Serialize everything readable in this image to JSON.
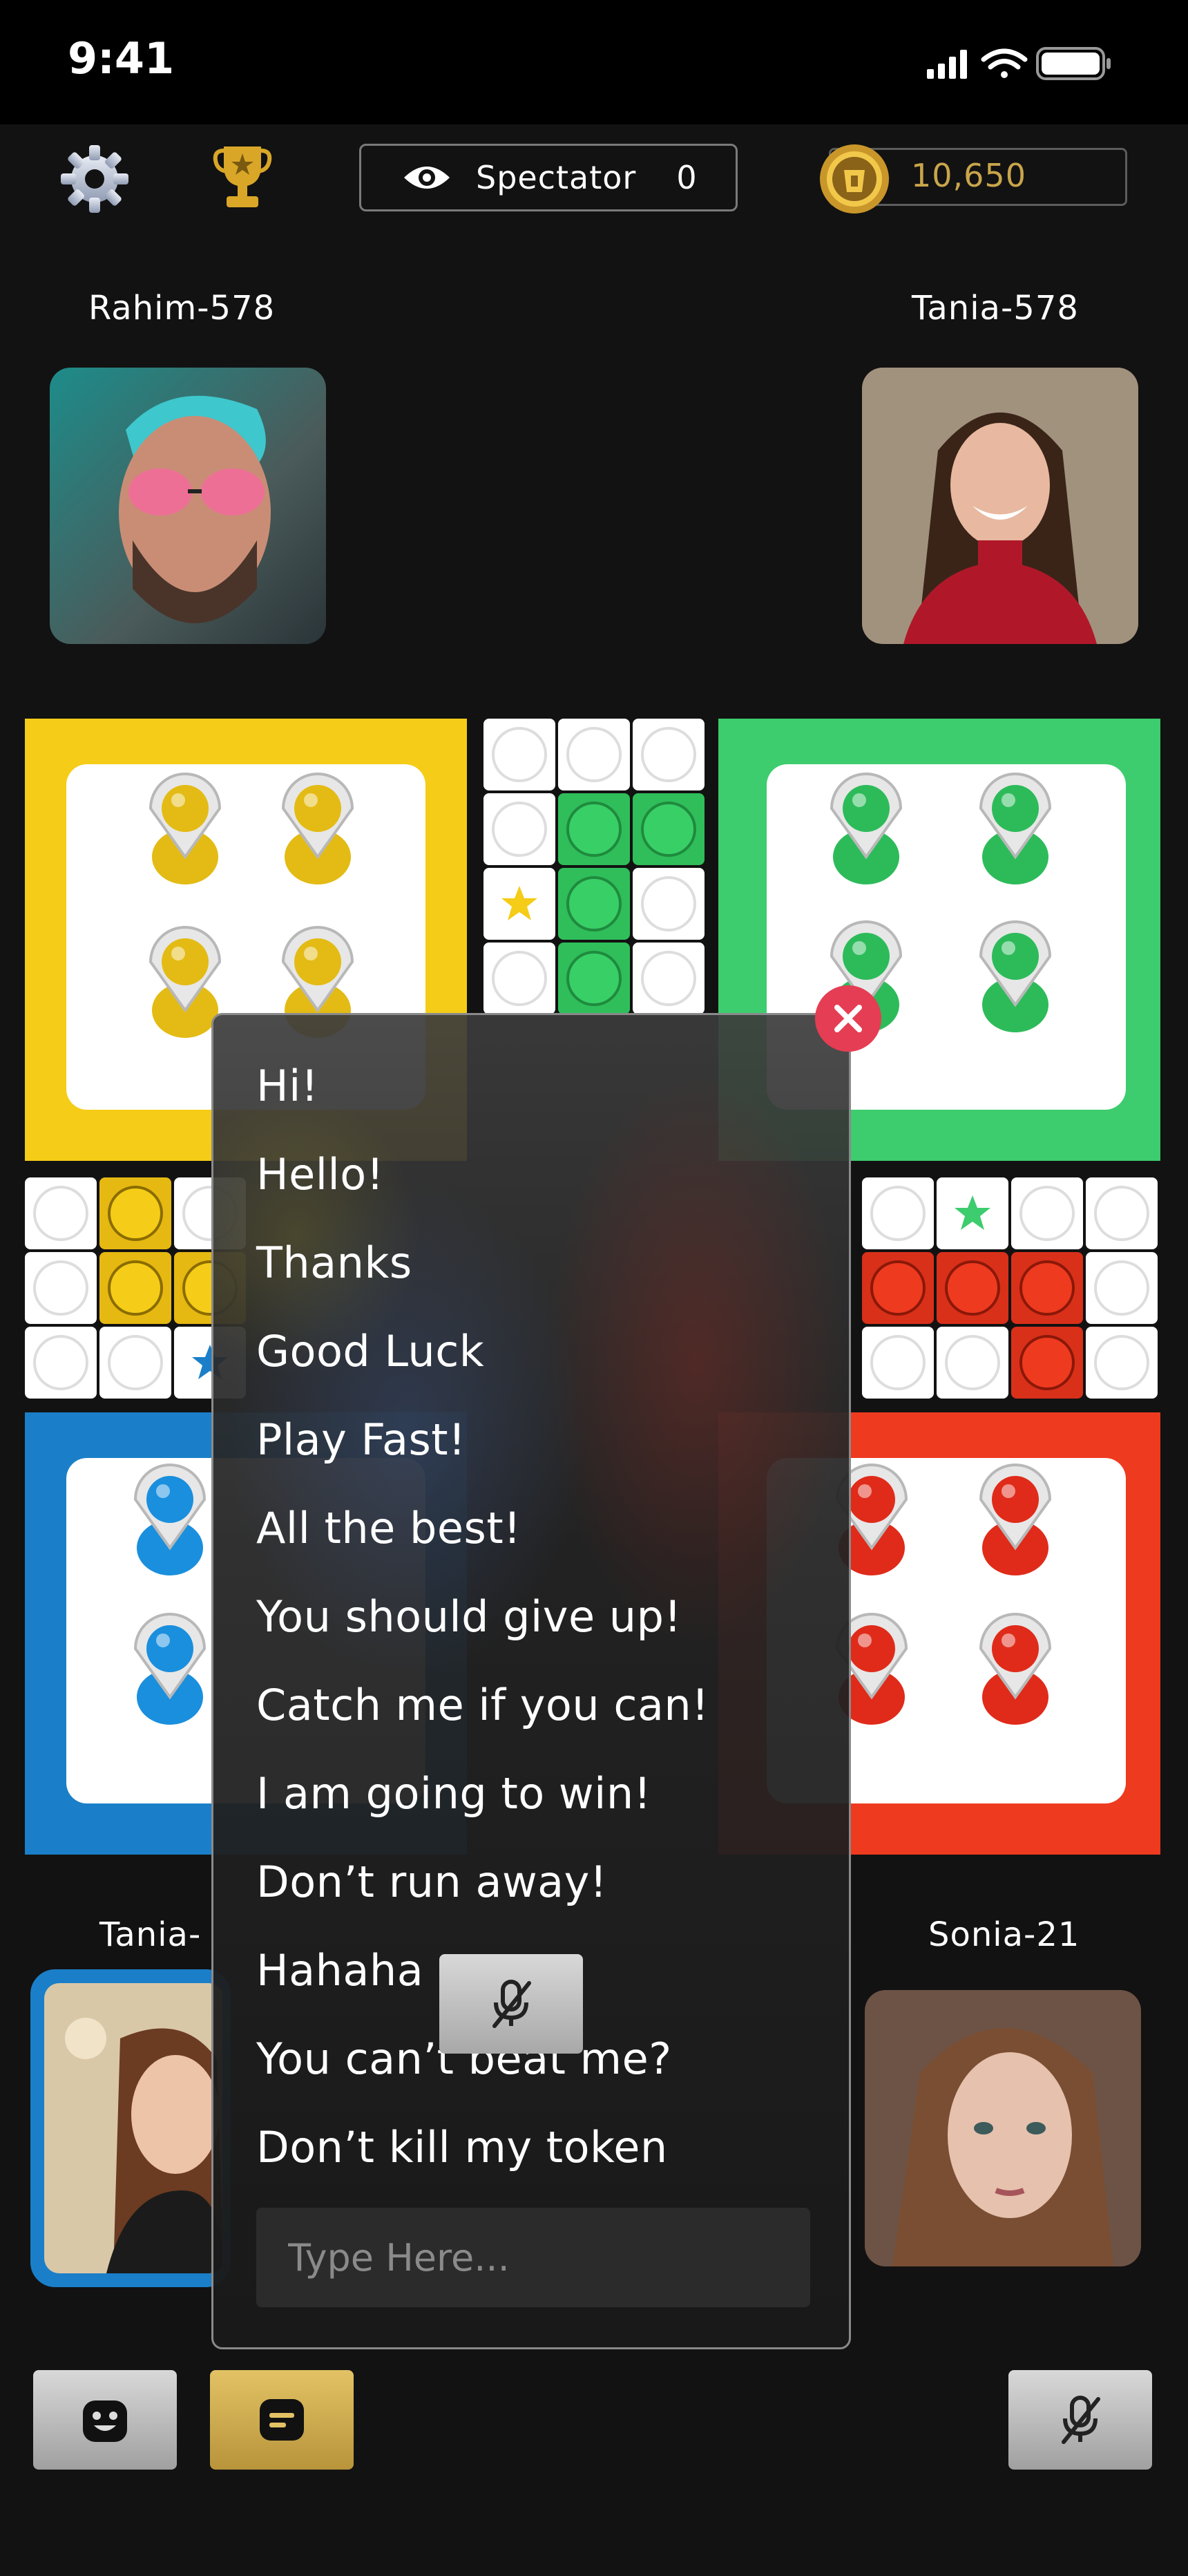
{
  "status_bar": {
    "time": "9:41"
  },
  "top_bar": {
    "settings_icon": "gear-icon",
    "trophy_icon": "trophy-icon",
    "spectator_label": "Spectator",
    "spectator_count": "0",
    "coins": "10,650"
  },
  "players": {
    "top_left": {
      "name": "Rahim-578",
      "color": "#f5cc17"
    },
    "top_right": {
      "name": "Tania-578",
      "color": "#3dcc6e"
    },
    "bottom_left": {
      "name": "Tania-",
      "color": "#1a88d4",
      "active": true
    },
    "bottom_right": {
      "name": "Sonia-21",
      "color": "#ee3a1f"
    }
  },
  "colors": {
    "yellow": "#f5cc17",
    "green": "#3dcc6e",
    "blue": "#1a7fc8",
    "red": "#ee3a1f",
    "close": "#e53d53",
    "gold_text": "#c9a54b"
  },
  "chat": {
    "messages": [
      "Hi!",
      "Hello!",
      "Thanks",
      "Good Luck",
      "Play Fast!",
      "All the best!",
      "You should give up!",
      "Catch me if you can!",
      "I am going  to win!",
      "Don’t run away!",
      "Hahaha",
      "You can’t beat me?",
      "Don’t kill my token"
    ],
    "input_placeholder": "Type Here..."
  },
  "controls": {
    "emoji_icon": "emoji-icon",
    "chat_icon": "chat-icon",
    "mute_icon": "mic-off-icon"
  }
}
